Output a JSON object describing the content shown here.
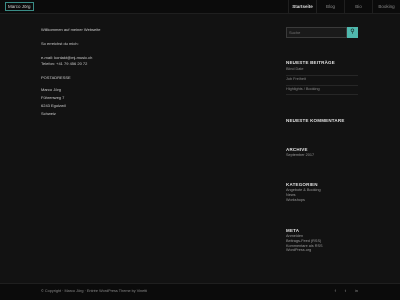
{
  "header": {
    "logo": "Marco Jörg",
    "nav": [
      "Startseite",
      "Blog",
      "Bio",
      "Booking"
    ]
  },
  "main": {
    "lines": [
      "Willkommen auf meiner Webseite",
      "So erreichst du mich:",
      "e-mail: kontakt@mj-music.ch",
      "Telefon: +41 79 456 20 72",
      "POSTADRESSE",
      "Marco Jörg",
      "Führenweg 7",
      "6243 Egolzwil",
      "Schweiz"
    ]
  },
  "sidebar": {
    "search_placeholder": "Suche",
    "search_icon": "search-icon",
    "recent_posts": {
      "title": "NEUESTE BEITRÄGE",
      "items": [
        "Blind Date",
        "Job Freiheit",
        "Highlights / Booking"
      ]
    },
    "recent_comments": {
      "title": "NEUESTE KOMMENTARE"
    },
    "archive": {
      "title": "ARCHIVE",
      "items": [
        "September 2017"
      ]
    },
    "categories": {
      "title": "KATEGORIEN",
      "items": [
        "Angebote & Booking",
        "News",
        "Workshops"
      ]
    },
    "meta": {
      "title": "META",
      "items": [
        "Anmelden",
        "Beitrags-Feed (RSS)",
        "Kommentare als RSS",
        "WordPress.org"
      ]
    }
  },
  "footer": {
    "text": "© Copyright · Marco Jörg · Entrée WordPress Theme by Vinetti",
    "socials": [
      "f",
      "t",
      "in"
    ]
  },
  "colors": {
    "accent": "#4fb8ad",
    "background": "#121212"
  }
}
